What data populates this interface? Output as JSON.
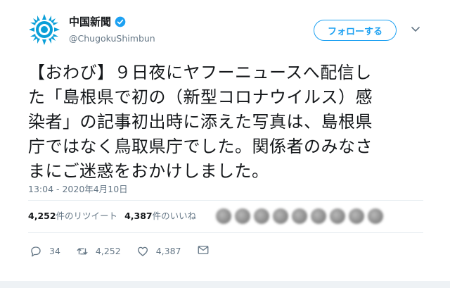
{
  "user": {
    "name": "中国新聞",
    "handle": "@ChugokuShimbun",
    "verified": true,
    "avatar_icon": "chugoku-shimbun-logo-icon"
  },
  "follow_label": "フォローする",
  "tweet": {
    "lines": [
      "【おわび】９日夜にヤフーニュースへ配信し",
      "た「島根県で初の（新型コロナウイルス）感",
      "染者」の記事初出時に添えた写真は、島根県",
      "庁ではなく鳥取県庁でした。関係者のみなさ",
      "まにご迷惑をおかけしました。"
    ],
    "timestamp": "13:04 - 2020年4月10日"
  },
  "stats": {
    "retweets_count": "4,252",
    "retweets_label": "件のリツイート",
    "likes_count": "4,387",
    "likes_label": "件のいいね"
  },
  "actions": {
    "reply_count": "34",
    "retweet_count": "4,252",
    "like_count": "4,387"
  },
  "colors": {
    "accent": "#1da1f2",
    "text": "#14171a",
    "muted": "#657786",
    "divider": "#e6ecf0"
  }
}
